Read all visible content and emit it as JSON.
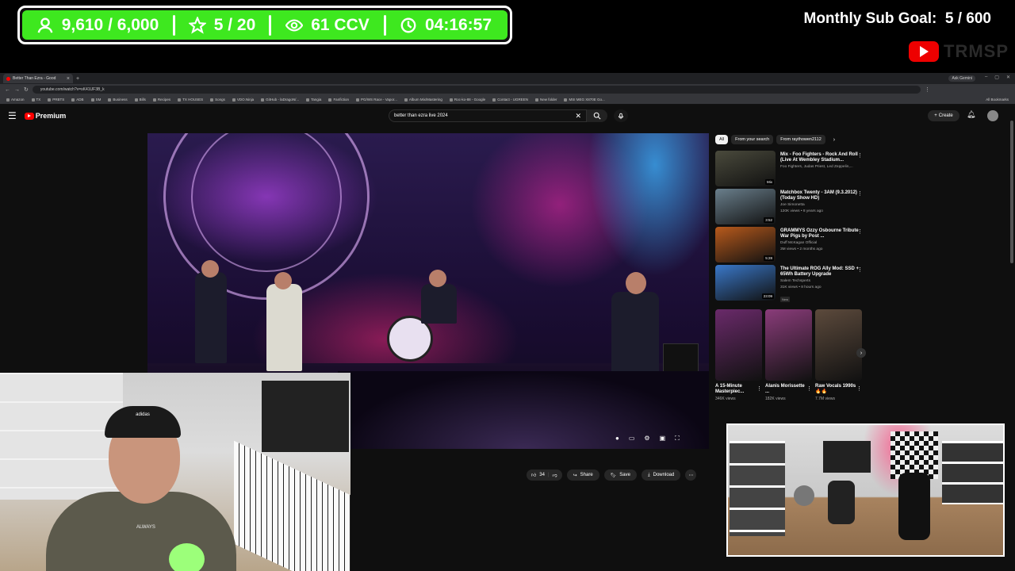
{
  "overlay": {
    "followers": "9,610 / 6,000",
    "stars": "5 / 20",
    "viewers": "61 CCV",
    "timer": "04:16:57",
    "goal_label": "Monthly Sub Goal:",
    "goal_value": "5 / 600",
    "brand": "TRMSP"
  },
  "browser": {
    "tab_title": "Better Than Ezra - Good",
    "ask_gemini": "Ask Gemini",
    "url": "youtube.com/watch?v=sK41UF3B_k",
    "bookmarks": [
      "Amazon",
      "TX",
      "PRBTS",
      "ADB",
      "SM",
      "Business",
      "Bills",
      "Recipes",
      "TX HOUSES",
      "Songs",
      "VDO.Ninja",
      "GitHub - laDragoN/...",
      "Tangia",
      "Fanfiction",
      "PG/WS Race - Vapor...",
      "Album Mix/Mastering",
      "Roc-ko-88 - Google",
      "Contact - UGREEN",
      "New folder",
      "MSI MEG X870E Go..."
    ],
    "all_bookmarks": "All Bookmarks"
  },
  "youtube": {
    "logo_text": "Premium",
    "search_value": "better than ezra live 2024",
    "create_label": "Create",
    "actions": {
      "likes": "34",
      "share": "Share",
      "save": "Save",
      "download": "Download"
    },
    "chips": [
      "All",
      "From your search",
      "From raythowen2112"
    ],
    "recommendations": [
      {
        "title": "Mix - Foo Fighters - Rock And Roll (Live At Wembley Stadium...",
        "meta1": "Foo Fighters, Judas Priest, Led Zeppelin,...",
        "meta2": "",
        "badge": "Mix",
        "thumb_color": "#4a4a3c"
      },
      {
        "title": "Matchbox Twenty - 3AM (9.3.2012)(Today Show HD)",
        "meta1": "Joe Simonetta",
        "meta2": "120K views • 8 years ago",
        "badge": "3:52",
        "thumb_color": "#6a7f8c"
      },
      {
        "title": "GRAMMYS Ozzy Osbourne Tribute War Pigs by Post ...",
        "meta1": "Duff McKagan Official",
        "meta2": "3M views • 2 months ago",
        "badge": "5:28",
        "thumb_color": "#b85a1c"
      },
      {
        "title": "The Ultimate ROG Ally Mod: SSD + 65Wh Battery Upgrade",
        "meta1": "Salem Techsperts",
        "meta2": "31K views • 8 hours ago",
        "badge": "23:09",
        "new_label": "New",
        "thumb_color": "#3a78c9"
      }
    ],
    "shorts": [
      {
        "title": "A 15-Minute Masterpiec...",
        "views": "346K views",
        "thumb_color": "#6a2a6a"
      },
      {
        "title": "Alanis Morissette ...",
        "views": "182K views",
        "thumb_color": "#8a3c7a"
      },
      {
        "title": "Raw Vocals 1990s 🔥🔥",
        "views": "7.7M views",
        "thumb_color": "#5c4a3c"
      }
    ]
  },
  "cam": {
    "cap_logo": "adidas",
    "shirt_text": "ALWAYS"
  },
  "colors": {
    "overlay_green": "#3ee81f",
    "youtube_red": "#ff0000",
    "page_bg": "#0f0f0f"
  }
}
